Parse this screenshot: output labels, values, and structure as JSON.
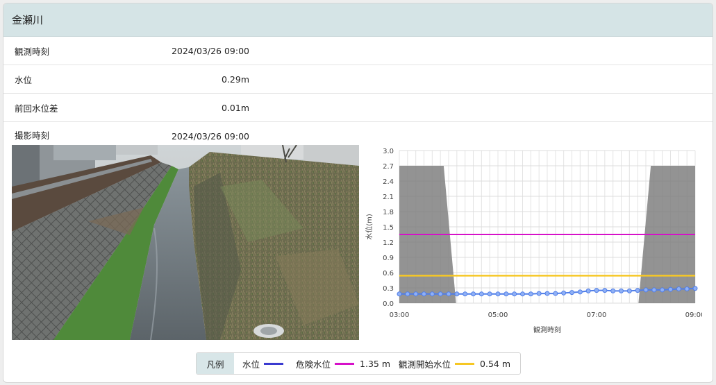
{
  "header": {
    "title": "金瀬川"
  },
  "info": [
    {
      "label": "観測時刻",
      "value": "2024/03/26 09:00"
    },
    {
      "label": "水位",
      "value": "0.29m"
    },
    {
      "label": "前回水位差",
      "value": "0.01m"
    },
    {
      "label": "撮影時刻",
      "value": "2024/03/26 09:00"
    }
  ],
  "legend": {
    "title": "凡例",
    "water_level": {
      "label": "水位",
      "color": "#3b3bd0"
    },
    "danger_level": {
      "label": "危険水位",
      "value": "1.35 m",
      "color": "#d611c9"
    },
    "obs_start_level": {
      "label": "観測開始水位",
      "value": "0.54 m",
      "color": "#f6c724"
    }
  },
  "chart_data": {
    "type": "line",
    "xlabel": "観測時刻",
    "ylabel": "水位(m)",
    "ylim": [
      0,
      3.0
    ],
    "y_ticks": [
      "0.0",
      "0.3",
      "0.6",
      "0.9",
      "1.2",
      "1.5",
      "1.8",
      "2.1",
      "2.4",
      "2.7",
      "3.0"
    ],
    "x_ticks": [
      "03:00",
      "05:00",
      "07:00",
      "09:00"
    ],
    "grid": true,
    "series": [
      {
        "name": "水位",
        "color": "#4f7de8",
        "x_hours": [
          3.0,
          3.167,
          3.333,
          3.5,
          3.667,
          3.833,
          4.0,
          4.167,
          4.333,
          4.5,
          4.667,
          4.833,
          5.0,
          5.167,
          5.333,
          5.5,
          5.667,
          5.833,
          6.0,
          6.167,
          6.333,
          6.5,
          6.667,
          6.833,
          7.0,
          7.167,
          7.333,
          7.5,
          7.667,
          7.833,
          8.0,
          8.167,
          8.333,
          8.5,
          8.667,
          8.833,
          9.0
        ],
        "values": [
          0.18,
          0.18,
          0.18,
          0.18,
          0.18,
          0.18,
          0.18,
          0.18,
          0.18,
          0.18,
          0.18,
          0.18,
          0.18,
          0.18,
          0.18,
          0.18,
          0.18,
          0.19,
          0.19,
          0.19,
          0.2,
          0.21,
          0.22,
          0.24,
          0.25,
          0.25,
          0.24,
          0.24,
          0.24,
          0.25,
          0.26,
          0.26,
          0.26,
          0.27,
          0.28,
          0.28,
          0.29
        ]
      }
    ],
    "danger_level": 1.35,
    "obs_start_level": 0.54,
    "shade_color": "#808080"
  }
}
